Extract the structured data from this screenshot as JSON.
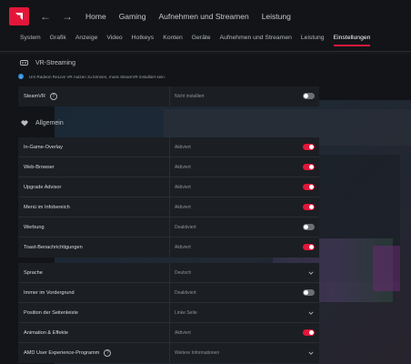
{
  "topnav": {
    "back_icon": "arrow-left-icon",
    "forward_icon": "arrow-right-icon",
    "items": [
      "Home",
      "Gaming",
      "Aufnehmen und Streamen",
      "Leistung"
    ]
  },
  "subnav": {
    "items": [
      "System",
      "Grafik",
      "Anzeige",
      "Video",
      "Hotkeys",
      "Konten",
      "Geräte",
      "Aufnehmen und Streamen",
      "Leistung",
      "Einstellungen"
    ],
    "active": "Einstellungen"
  },
  "vr": {
    "title": "VR-Streaming",
    "info": "Um Radeon ReLive VR nutzen zu können, muss SteamVR installiert sein.",
    "rows": [
      {
        "label": "SteamVR",
        "value": "Nicht installiert",
        "control": "toggle",
        "state": "off",
        "help": true
      }
    ]
  },
  "general": {
    "title": "Allgemein",
    "rows": [
      {
        "label": "In-Game-Overlay",
        "value": "Aktiviert",
        "control": "toggle",
        "state": "on"
      },
      {
        "label": "Web-Browser",
        "value": "Aktiviert",
        "control": "toggle",
        "state": "on"
      },
      {
        "label": "Upgrade Advisor",
        "value": "Aktiviert",
        "control": "toggle",
        "state": "on"
      },
      {
        "label": "Menü im Infobereich",
        "value": "Aktiviert",
        "control": "toggle",
        "state": "on"
      },
      {
        "label": "Werbung",
        "value": "Deaktiviert",
        "control": "toggle",
        "state": "off"
      },
      {
        "label": "Toast-Benachrichtigungen",
        "value": "Aktiviert",
        "control": "toggle",
        "state": "on"
      }
    ]
  },
  "misc": {
    "rows": [
      {
        "label": "Sprache",
        "value": "Deutsch",
        "control": "dropdown"
      },
      {
        "label": "Immer im Vordergrund",
        "value": "Deaktiviert",
        "control": "toggle",
        "state": "off"
      },
      {
        "label": "Position der Seitenleiste",
        "value": "Linke Seite",
        "control": "dropdown"
      },
      {
        "label": "Animation & Effekte",
        "value": "Aktiviert",
        "control": "toggle",
        "state": "on"
      },
      {
        "label": "AMD User Experience-Programm",
        "value": "Weitere Informationen",
        "control": "dropdown",
        "help": true
      }
    ]
  },
  "colors": {
    "accent": "#e3163a",
    "info": "#2f8fe0",
    "panel": "#1b1e22",
    "background": "#121417"
  }
}
